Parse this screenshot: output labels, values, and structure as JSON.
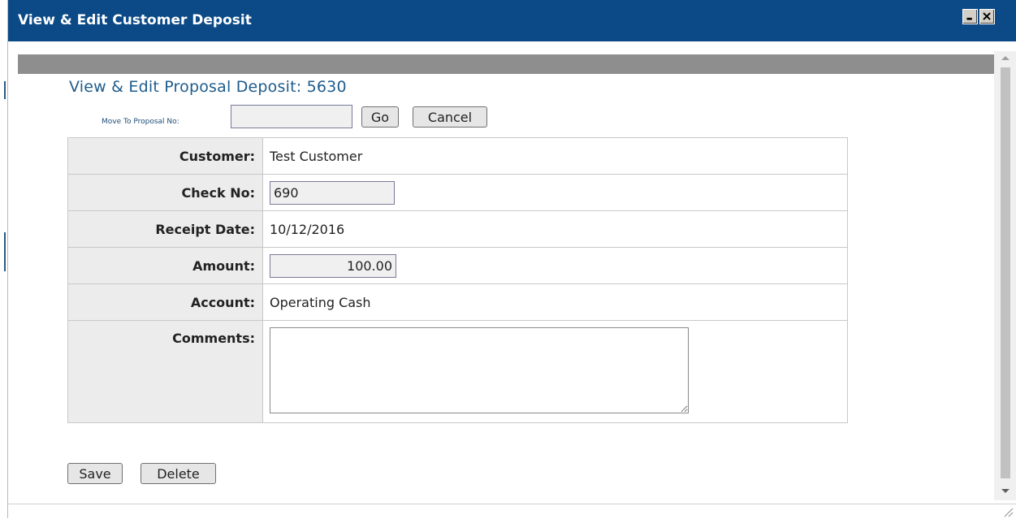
{
  "window": {
    "title": "View & Edit Customer Deposit",
    "minimize_icon": "minimize-icon",
    "close_icon": "close-icon"
  },
  "page": {
    "heading": "View & Edit Proposal Deposit: 5630"
  },
  "move_to": {
    "label": "Move To Proposal No:",
    "value": "",
    "go_label": "Go",
    "cancel_label": "Cancel"
  },
  "form": {
    "customer": {
      "label": "Customer:",
      "value": "Test Customer"
    },
    "check_no": {
      "label": "Check No:",
      "value": "690"
    },
    "receipt_date": {
      "label": "Receipt Date:",
      "value": "10/12/2016"
    },
    "amount": {
      "label": "Amount:",
      "value": "100.00"
    },
    "account": {
      "label": "Account:",
      "value": "Operating Cash"
    },
    "comments": {
      "label": "Comments:",
      "value": ""
    }
  },
  "actions": {
    "save_label": "Save",
    "delete_label": "Delete"
  },
  "colors": {
    "titlebar": "#0b4a86",
    "heading": "#1e5c8c",
    "label_cell": "#ececec",
    "graybar": "#8e8e8e"
  }
}
